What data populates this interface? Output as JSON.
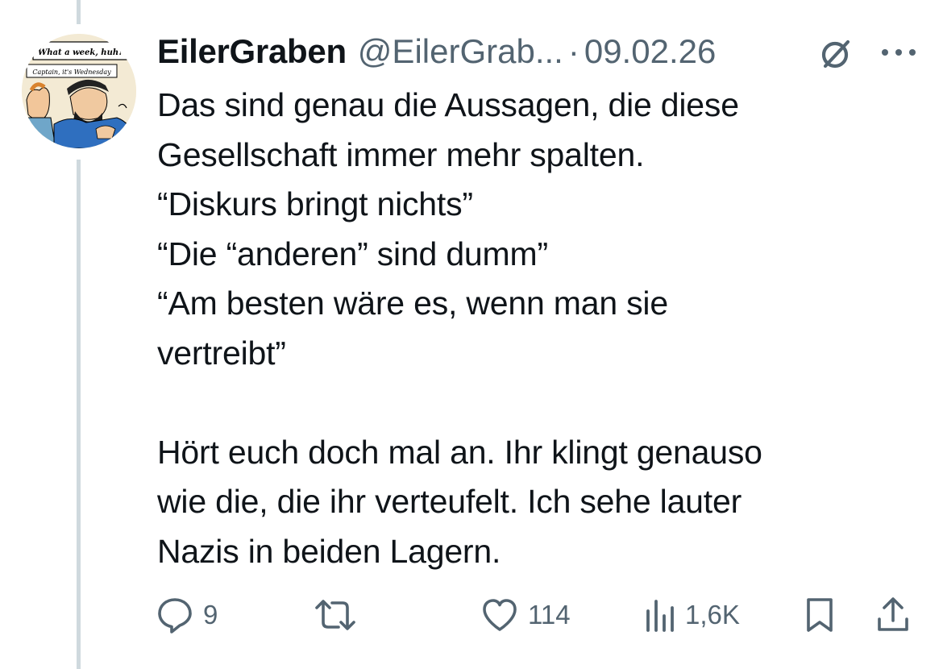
{
  "avatar": {
    "caption_top": "What a week, huh?",
    "caption_bottom": "Captain, it's Wednesday"
  },
  "author": {
    "display_name": "EilerGraben",
    "handle": "@EilerGrab...",
    "separator": "·",
    "date": "09.02.26"
  },
  "tweet": {
    "lines": [
      "Das sind genau die Aussagen, die diese",
      "Gesellschaft immer mehr spalten.",
      "“Diskurs bringt nichts”",
      "“Die “anderen” sind dumm”",
      "“Am besten wäre es, wenn man sie",
      "vertreibt”",
      "",
      "Hört euch doch mal an. Ihr klingt genauso",
      "wie die, die ihr verteufelt. Ich sehe lauter",
      "Nazis in beiden Lagern."
    ]
  },
  "actions": {
    "replies": "9",
    "retweets": "",
    "likes": "114",
    "views": "1,6K"
  },
  "icons": {
    "grok": "grok-icon",
    "more": "more-icon",
    "reply": "reply-icon",
    "retweet": "retweet-icon",
    "like": "heart-icon",
    "views": "views-icon",
    "bookmark": "bookmark-icon",
    "share": "share-icon"
  },
  "colors": {
    "text": "#0f1419",
    "secondary": "#536471",
    "thread_line": "#cfd9de"
  }
}
